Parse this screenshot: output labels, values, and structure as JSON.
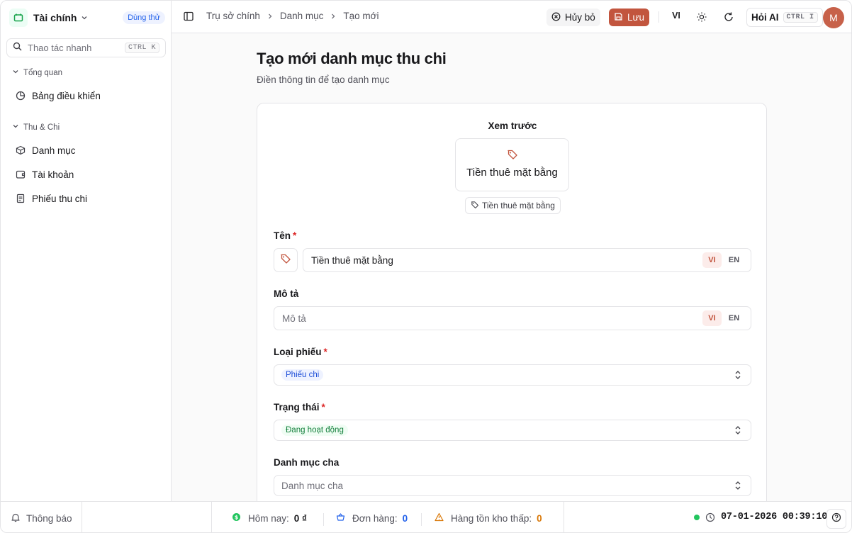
{
  "brand": {
    "name": "Tài chính",
    "trial_badge": "Dùng thử",
    "logo_color": "#16a34a"
  },
  "sidebar": {
    "quick_search": {
      "placeholder": "Thao tác nhanh",
      "shortcut": "CTRL K"
    },
    "groups": [
      {
        "label": "Tổng quan",
        "items": [
          {
            "label": "Bảng điều khiển",
            "icon": "pie-chart-icon"
          }
        ]
      },
      {
        "label": "Thu & Chi",
        "items": [
          {
            "label": "Danh mục",
            "icon": "package-icon"
          },
          {
            "label": "Tài khoản",
            "icon": "wallet-icon"
          },
          {
            "label": "Phiếu thu chi",
            "icon": "receipt-icon"
          }
        ]
      }
    ]
  },
  "header": {
    "breadcrumb": [
      "Trụ sở chính",
      "Danh mục",
      "Tạo mới"
    ],
    "cancel_label": "Hủy bỏ",
    "save_label": "Lưu",
    "language": "VI",
    "ask_ai_label": "Hỏi AI",
    "ask_ai_shortcut": "CTRL I",
    "avatar_initial": "M",
    "accent_color": "#c2553e"
  },
  "page": {
    "title": "Tạo mới danh mục thu chi",
    "subtitle": "Điền thông tin để tạo danh mục"
  },
  "form": {
    "preview": {
      "label": "Xem trước",
      "name": "Tiền thuê mặt bằng",
      "chip": "Tiền thuê mặt bằng"
    },
    "name": {
      "label": "Tên",
      "required_mark": "*",
      "value": "Tiền thuê mặt bằng",
      "languages": [
        "VI",
        "EN"
      ],
      "active_language": "VI"
    },
    "description": {
      "label": "Mô tả",
      "placeholder": "Mô tả",
      "languages": [
        "VI",
        "EN"
      ],
      "active_language": "VI"
    },
    "voucher_type": {
      "label": "Loại phiếu",
      "required_mark": "*",
      "value": "Phiếu chi"
    },
    "status": {
      "label": "Trạng thái",
      "required_mark": "*",
      "value": "Đang hoạt động"
    },
    "parent_category": {
      "label": "Danh mục cha",
      "placeholder": "Danh mục cha"
    }
  },
  "footer": {
    "notifications_label": "Thông báo",
    "today": {
      "label": "Hôm nay:",
      "value": "0 ₫"
    },
    "orders": {
      "label": "Đơn hàng:",
      "value": "0"
    },
    "low_stock": {
      "label": "Hàng tồn kho thấp:",
      "value": "0"
    },
    "datetime": "07-01-2026 00:39:10",
    "status_color": "#22c55e"
  }
}
